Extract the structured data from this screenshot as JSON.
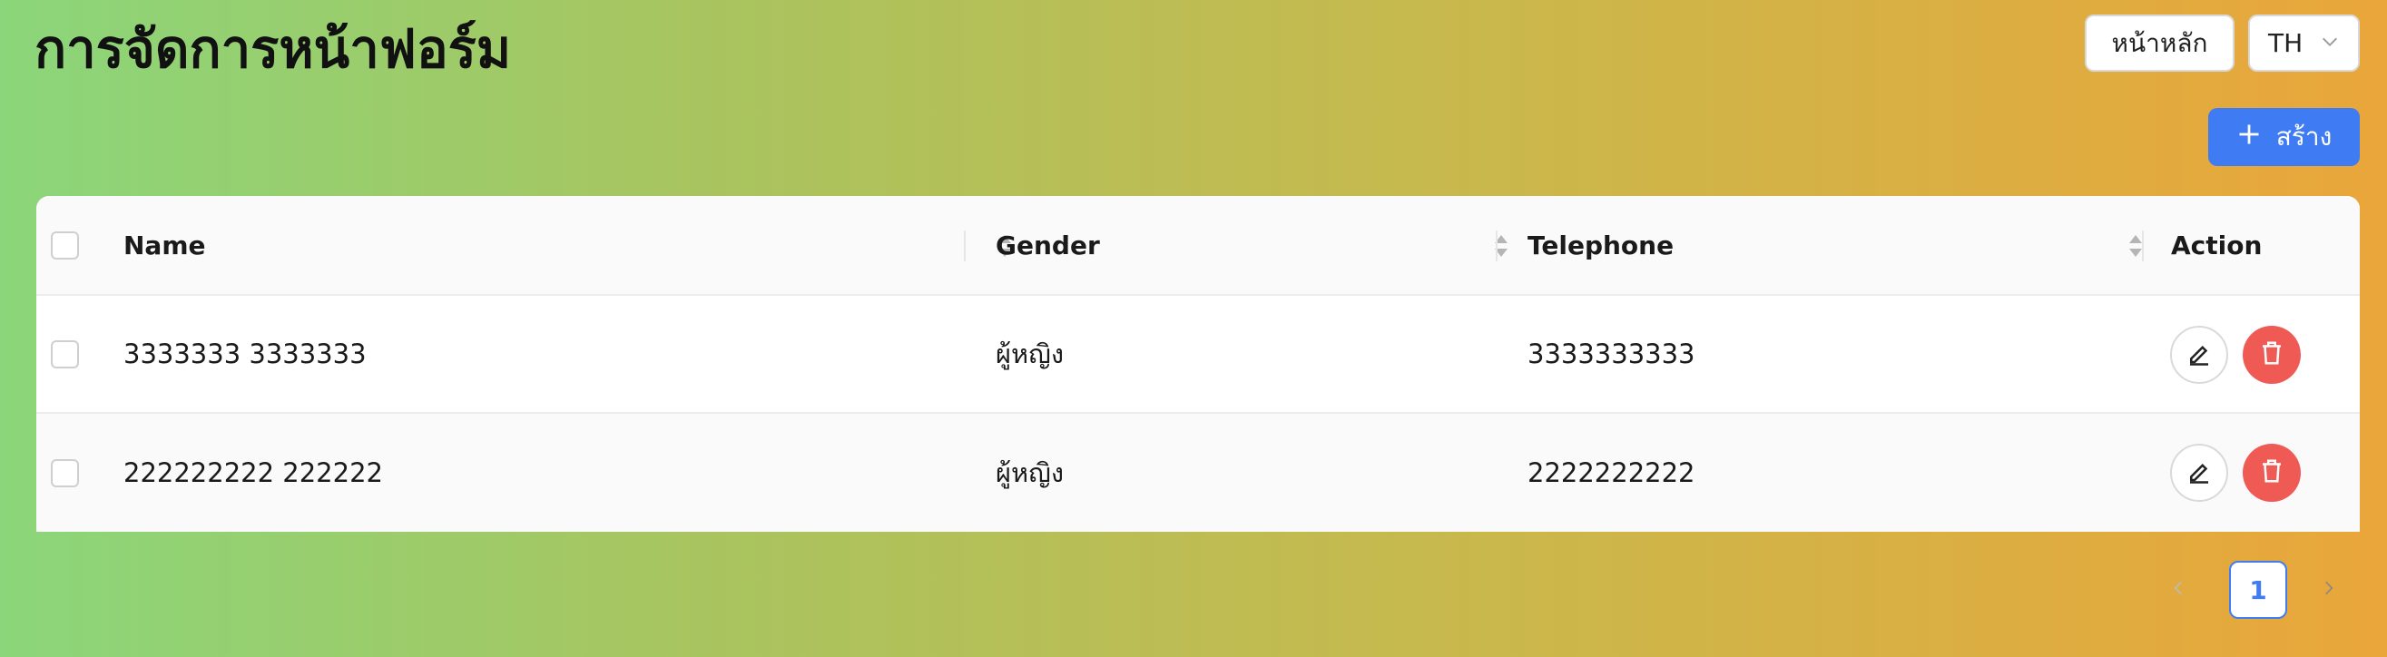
{
  "header": {
    "title": "การจัดการหน้าฟอร์ม",
    "home_label": "หน้าหลัก",
    "language": "TH",
    "create_label": "สร้าง"
  },
  "table": {
    "columns": [
      "Name",
      "Gender",
      "Telephone",
      "Action"
    ],
    "rows": [
      {
        "name": "3333333 3333333",
        "gender": "ผู้หญิง",
        "telephone": "3333333333"
      },
      {
        "name": "222222222 222222",
        "gender": "ผู้หญิง",
        "telephone": "2222222222"
      }
    ]
  },
  "pagination": {
    "current_page": "1"
  },
  "colors": {
    "primary": "#3f7cf3",
    "danger": "#ef5a55",
    "gradient_start": "#8bd67a",
    "gradient_end": "#eaa63a"
  }
}
